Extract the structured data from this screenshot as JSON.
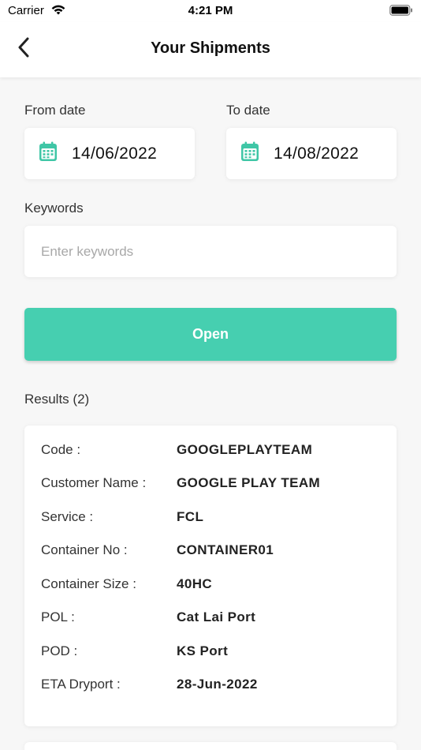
{
  "status_bar": {
    "carrier": "Carrier",
    "time": "4:21 PM",
    "wifi_icon": "wifi-icon",
    "battery_icon": "battery-icon"
  },
  "nav": {
    "title": "Your Shipments",
    "back_icon": "chevron-left-icon"
  },
  "filters": {
    "from_label": "From date",
    "from_value": "14/06/2022",
    "to_label": "To date",
    "to_value": "14/08/2022",
    "calendar_icon": "calendar-icon",
    "keywords_label": "Keywords",
    "keywords_placeholder": "Enter keywords",
    "keywords_value": "",
    "open_label": "Open"
  },
  "results": {
    "header": "Results (2)",
    "items": [
      {
        "rows": [
          {
            "label": "Code :",
            "value": "GOOGLEPLAYTEAM"
          },
          {
            "label": "Customer Name :",
            "value": "GOOGLE PLAY TEAM"
          },
          {
            "label": "Service :",
            "value": "FCL"
          },
          {
            "label": "Container No :",
            "value": "CONTAINER01"
          },
          {
            "label": "Container Size :",
            "value": "40HC"
          },
          {
            "label": "POL :",
            "value": "Cat Lai Port"
          },
          {
            "label": "POD :",
            "value": "KS Port"
          },
          {
            "label": "ETA Dryport :",
            "value": "28-Jun-2022"
          }
        ]
      }
    ]
  },
  "colors": {
    "accent": "#46cfb0",
    "calendar_icon": "#3fc6a6",
    "background": "#f7f7f7"
  }
}
